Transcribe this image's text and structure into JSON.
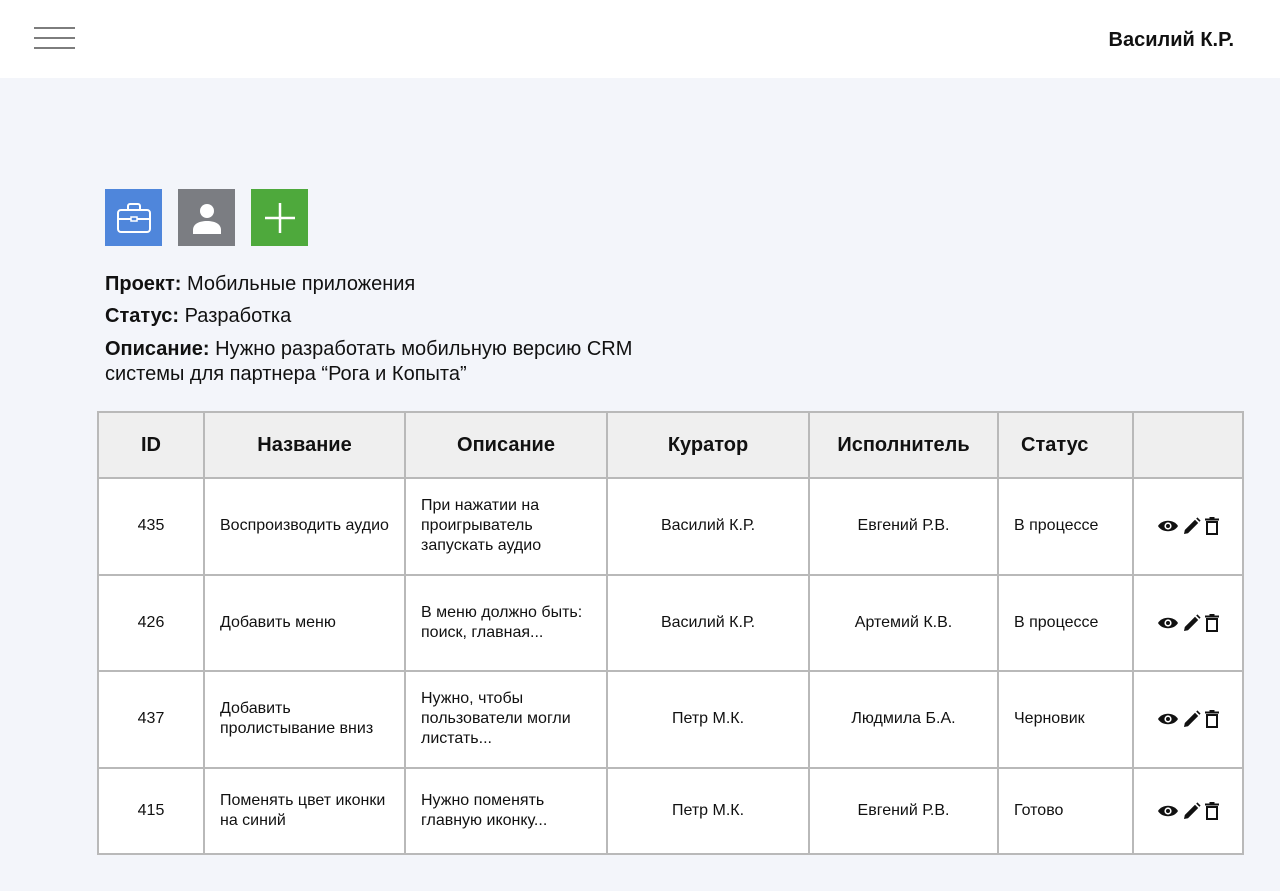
{
  "header": {
    "user_name": "Василий К.Р."
  },
  "toolbar": {
    "buttons": [
      {
        "icon": "briefcase-icon",
        "color": "#4f86db"
      },
      {
        "icon": "user-icon",
        "color": "#7b7d82"
      },
      {
        "icon": "plus-icon",
        "color": "#4ea93c"
      }
    ]
  },
  "project": {
    "name_label": "Проект:",
    "name": "Мобильные приложения",
    "status_label": "Статус:",
    "status": "Разработка",
    "description_label": "Описание:",
    "description": "Нужно разработать мобильную версию CRM системы для партнера “Рога и Копыта”"
  },
  "table": {
    "columns": [
      "ID",
      "Название",
      "Описание",
      "Куратор",
      "Исполнитель",
      "Статус",
      ""
    ],
    "rows": [
      {
        "id": "435",
        "title": "Воспроизводить аудио",
        "description": "При нажатии на проигрыватель запускать аудио",
        "curator": "Василий К.Р.",
        "assignee": "Евгений Р.В.",
        "status": "В процессе"
      },
      {
        "id": "426",
        "title": "Добавить меню",
        "description": "В меню должно быть: поиск, главная...",
        "curator": "Василий К.Р.",
        "assignee": "Артемий К.В.",
        "status": "В процессе"
      },
      {
        "id": "437",
        "title": "Добавить пролистывание вниз",
        "description": "Нужно, чтобы пользователи могли листать...",
        "curator": "Петр М.К.",
        "assignee": "Людмила Б.А.",
        "status": "Черновик"
      },
      {
        "id": "415",
        "title": "Поменять цвет иконки на синий",
        "description": "Нужно поменять главную иконку...",
        "curator": "Петр М.К.",
        "assignee": "Евгений Р.В.",
        "status": "Готово"
      }
    ]
  }
}
